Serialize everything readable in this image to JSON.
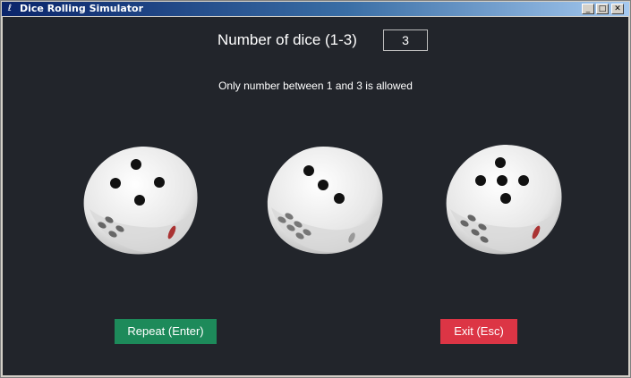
{
  "window": {
    "title": "Dice Rolling Simulator",
    "minimize_glyph": "_",
    "maximize_glyph": "□",
    "close_glyph": "✕"
  },
  "header": {
    "label": "Number of dice (1-3)",
    "input_value": "3"
  },
  "hint": "Only number between 1 and 3 is allowed",
  "dice": [
    {
      "name": "die-1",
      "face": 4
    },
    {
      "name": "die-2",
      "face": 3
    },
    {
      "name": "die-3",
      "face": 5
    }
  ],
  "buttons": {
    "repeat_label": "Repeat (Enter)",
    "exit_label": "Exit (Esc)"
  },
  "colors": {
    "background": "#22252b",
    "repeat": "#1d8a5a",
    "exit": "#dc3545"
  }
}
